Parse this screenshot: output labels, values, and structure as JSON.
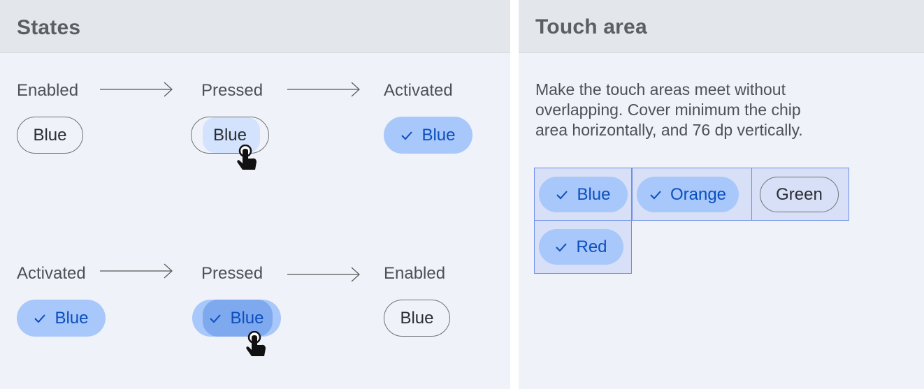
{
  "states_panel": {
    "title": "States",
    "row1": {
      "labels": [
        "Enabled",
        "Pressed",
        "Activated"
      ],
      "chips": [
        "Blue",
        "Blue",
        "Blue"
      ]
    },
    "row2": {
      "labels": [
        "Activated",
        "Pressed",
        "Enabled"
      ],
      "chips": [
        "Blue",
        "Blue",
        "Blue"
      ]
    }
  },
  "touch_panel": {
    "title": "Touch area",
    "description": "Make the touch areas meet without overlapping. Cover minimum the chip area horizontally, and 76 dp vertically.",
    "chips": [
      {
        "label": "Blue",
        "selected": true
      },
      {
        "label": "Orange",
        "selected": true
      },
      {
        "label": "Green",
        "selected": false
      },
      {
        "label": "Red",
        "selected": true
      }
    ]
  },
  "icons": {
    "check": "check-icon",
    "arrow": "arrow-right-icon",
    "cursor": "hand-pointer-icon"
  },
  "colors": {
    "panel_bg": "#eff2f8",
    "header_bg": "#e3e6ea",
    "chip_selected_bg": "#a8c7fa",
    "chip_selected_text": "#0b4fbd",
    "pressed_ripple": "#d3e3fd",
    "touch_area_border": "#6d8fe8"
  }
}
